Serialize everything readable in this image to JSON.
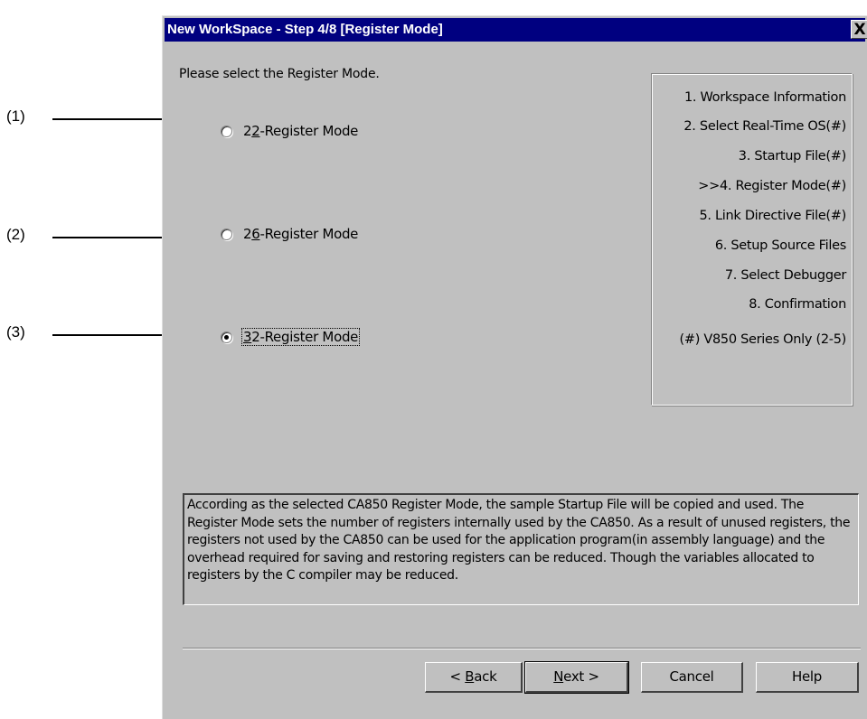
{
  "callouts": [
    "(1)",
    "(2)",
    "(3)"
  ],
  "dialog": {
    "title": "New WorkSpace - Step 4/8 [Register Mode]",
    "close_label": "X",
    "instruction": "Please select the Register Mode.",
    "options": [
      {
        "pre": "2",
        "mnemonic": "2",
        "post": "-Register Mode",
        "selected": false
      },
      {
        "pre": "2",
        "mnemonic": "6",
        "post": "-Register Mode",
        "selected": false
      },
      {
        "pre": "",
        "mnemonic": "3",
        "post": "2-Register Mode",
        "selected": true
      }
    ],
    "steps": [
      "1. Workspace Information",
      "2. Select Real-Time OS(#)",
      "3. Startup File(#)",
      ">>4. Register Mode(#)",
      "5. Link Directive File(#)",
      "6. Setup Source Files",
      "7. Select Debugger",
      "8. Confirmation",
      "(#) V850 Series Only (2-5)"
    ],
    "description": "According as the selected CA850 Register Mode, the sample Startup File will be copied and used. The Register Mode sets the number of registers internally used by the CA850. As a result of unused registers, the registers not used by the CA850 can be used for the application program(in assembly language) and the overhead required for saving and restoring registers can be reduced. Though the variables allocated to registers by the C compiler may be reduced.",
    "buttons": {
      "back": {
        "pre": "< ",
        "mnemonic": "B",
        "post": "ack"
      },
      "next": {
        "pre": "",
        "mnemonic": "N",
        "post": "ext >"
      },
      "cancel": "Cancel",
      "help": "Help"
    }
  }
}
